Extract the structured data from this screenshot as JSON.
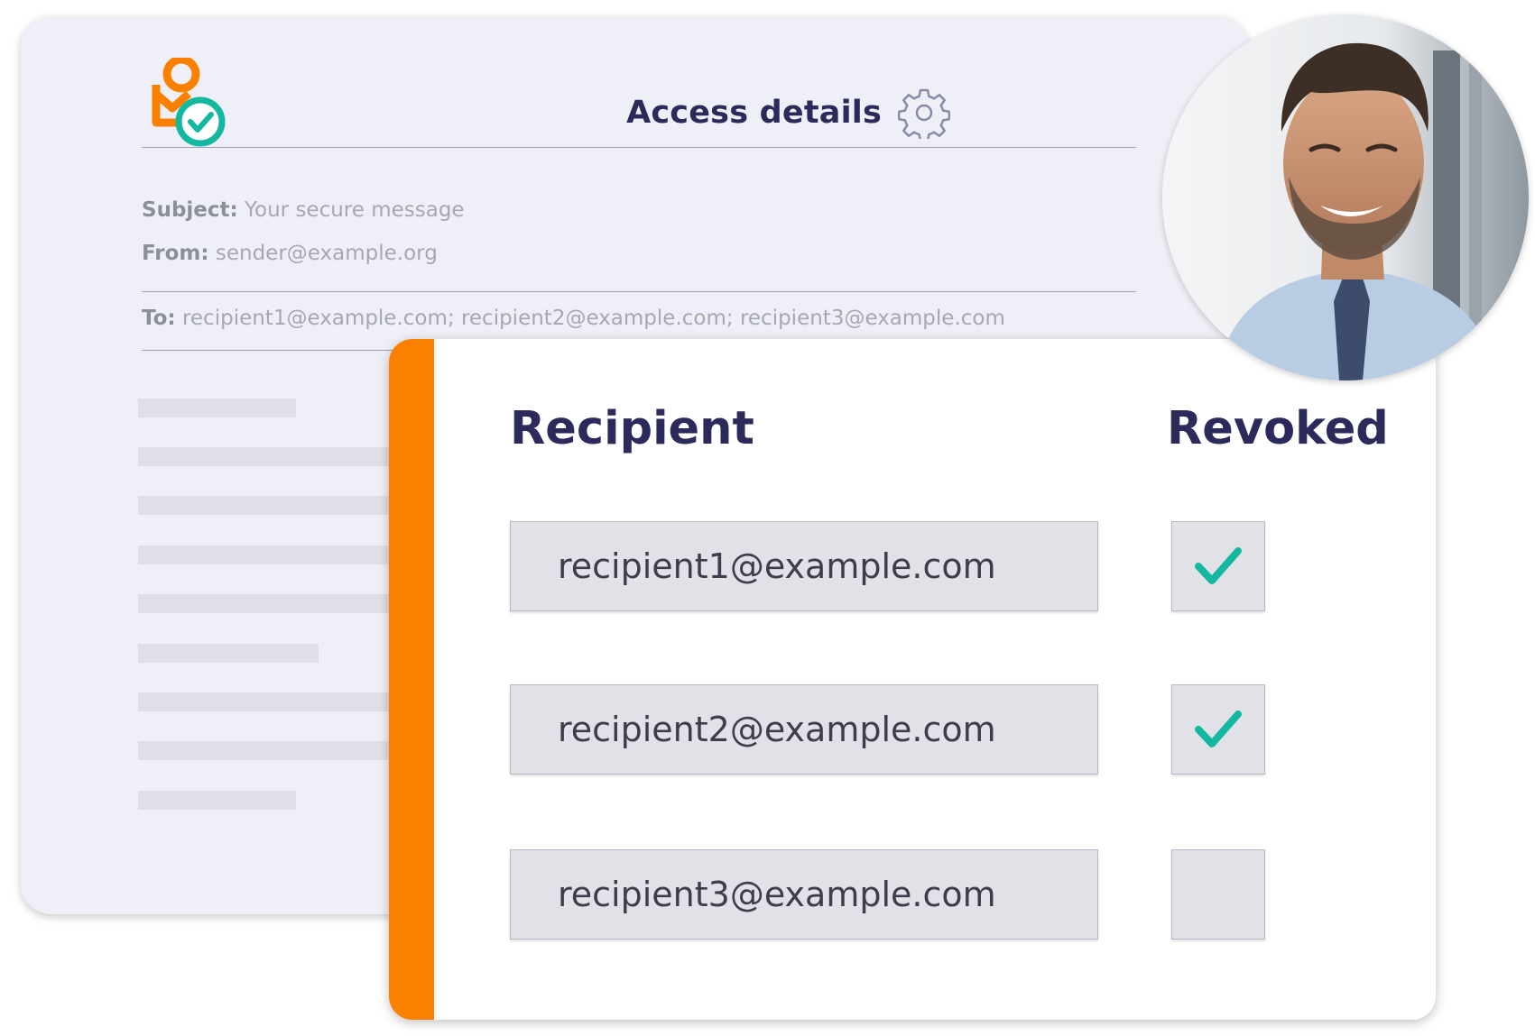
{
  "header": {
    "access_details_label": "Access details"
  },
  "message": {
    "subject_label": "Subject:",
    "subject_value": "Your secure message",
    "from_label": "From:",
    "from_value": "sender@example.org",
    "to_label": "To:",
    "to_value": "recipient1@example.com; recipient2@example.com; recipient3@example.com"
  },
  "access_table": {
    "recipient_header": "Recipient",
    "revoked_header": "Revoked",
    "rows": [
      {
        "email": "recipient1@example.com",
        "revoked": true
      },
      {
        "email": "recipient2@example.com",
        "revoked": true
      },
      {
        "email": "recipient3@example.com",
        "revoked": false
      }
    ]
  },
  "colors": {
    "brand_orange": "#fb8000",
    "brand_teal": "#14b8a0",
    "heading_navy": "#2b2a5a"
  },
  "icons": [
    "logo-icon",
    "gear-icon",
    "checkmark-icon"
  ]
}
